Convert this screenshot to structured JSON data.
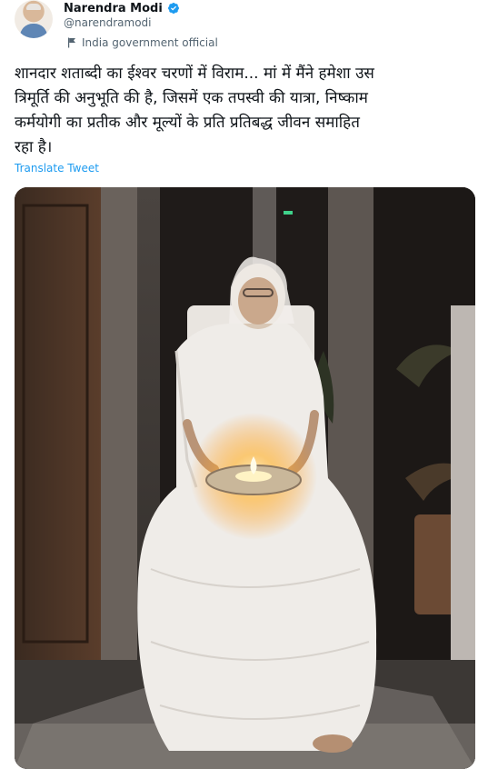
{
  "author": {
    "name": "Narendra Modi",
    "handle": "@narendramodi",
    "label": "India government official",
    "verified": true,
    "avatar_icon": "profile-photo",
    "badge_color": "#1d9bf0"
  },
  "tweet": {
    "text_lines": [
      "शानदार शताब्दी का ईश्वर चरणों में विराम... मां में मैंने हमेशा उस",
      "त्रिमूर्ति की अनुभूति की है, जिसमें एक तपस्वी की यात्रा, निष्काम",
      "कर्मयोगी का प्रतीक और मूल्यों के प्रति प्रतिबद्ध जीवन समाहित",
      "रहा है।"
    ],
    "translate_label": "Translate Tweet"
  },
  "media": {
    "type": "photo",
    "subject": "elderly woman holding a lit lamp"
  },
  "colors": {
    "text": "#0f1419",
    "secondary": "#536471",
    "link": "#1d9bf0"
  }
}
